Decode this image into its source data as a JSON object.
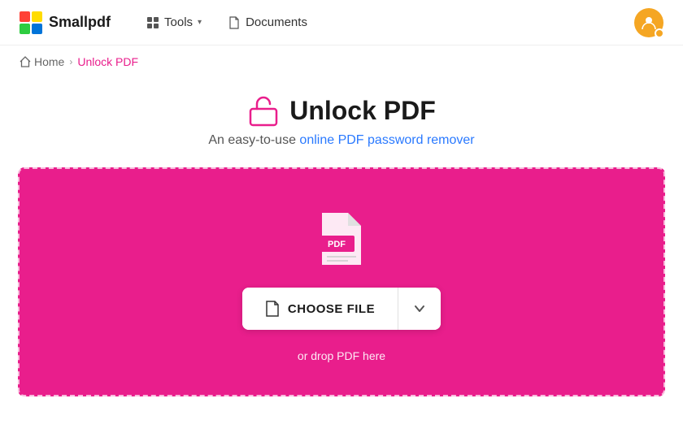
{
  "header": {
    "logo_text": "Smallpdf",
    "nav_tools_label": "Tools",
    "nav_documents_label": "Documents"
  },
  "breadcrumb": {
    "home_label": "Home",
    "separator": "›",
    "current_label": "Unlock PDF"
  },
  "page": {
    "title": "Unlock PDF",
    "subtitle": "An easy-to-use online PDF password remover"
  },
  "dropzone": {
    "choose_file_label": "CHOOSE FILE",
    "drop_hint": "or drop PDF here"
  },
  "colors": {
    "brand_pink": "#e91e8c",
    "brand_blue": "#2979ff",
    "avatar_orange": "#f5a623"
  }
}
